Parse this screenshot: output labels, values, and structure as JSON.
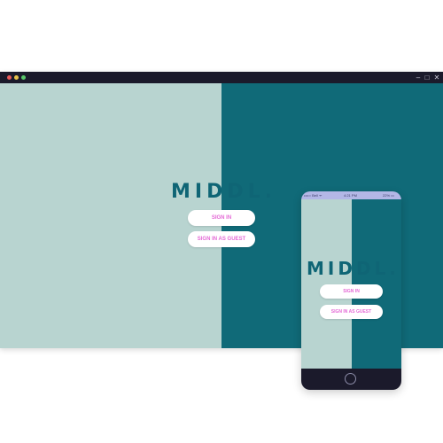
{
  "colors": {
    "light_teal": "#b8d4d0",
    "dark_teal": "#106a78",
    "brand_text": "#0f6575",
    "button_text": "#e46ad6",
    "frame": "#1b1a2b",
    "phone_status_bg": "#b3b7e6",
    "dot_red": "#e85a5a",
    "dot_yellow": "#e8c24a",
    "dot_green": "#5ac86a"
  },
  "window": {
    "controls": {
      "minimize": "–",
      "maximize": "□",
      "close": "✕"
    }
  },
  "desktop": {
    "brand": "MIDDL.",
    "sign_in_label": "SIGN IN",
    "guest_label": "SIGN IN AS GUEST"
  },
  "phone": {
    "status": {
      "carrier": "••••○ Bell ᯤ",
      "time": "4:21 PM",
      "battery": "22% ▭"
    },
    "brand": "MIDDL.",
    "sign_in_label": "SIGN IN",
    "guest_label": "SIGN IN AS GUEST",
    "home_button": "home-button-icon"
  }
}
